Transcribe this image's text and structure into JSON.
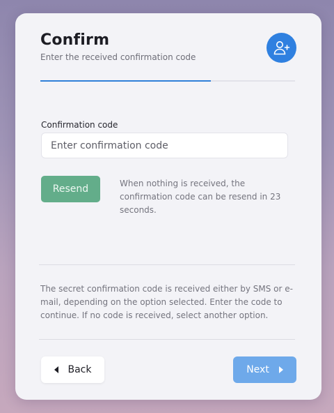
{
  "header": {
    "title": "Confirm",
    "subtitle": "Enter the received confirmation code",
    "avatar_icon": "user-add-icon",
    "accent_color": "#2f80e0"
  },
  "progress": {
    "fraction": 0.67
  },
  "form": {
    "code_label": "Confirmation code",
    "code_placeholder": "Enter confirmation code",
    "code_value": ""
  },
  "resend": {
    "button_label": "Resend",
    "button_color": "#63ad8a",
    "note": "When nothing is received, the confirmation code can be resend in 23 seconds."
  },
  "info": {
    "text": "The secret confirmation code is received either by SMS or e-mail, depending on the option selected. Enter the code to continue. If no code is received, select another option."
  },
  "footer": {
    "back_label": "Back",
    "back_icon": "caret-left-icon",
    "next_label": "Next",
    "next_icon": "caret-right-icon",
    "next_color": "#6ea9ea"
  }
}
